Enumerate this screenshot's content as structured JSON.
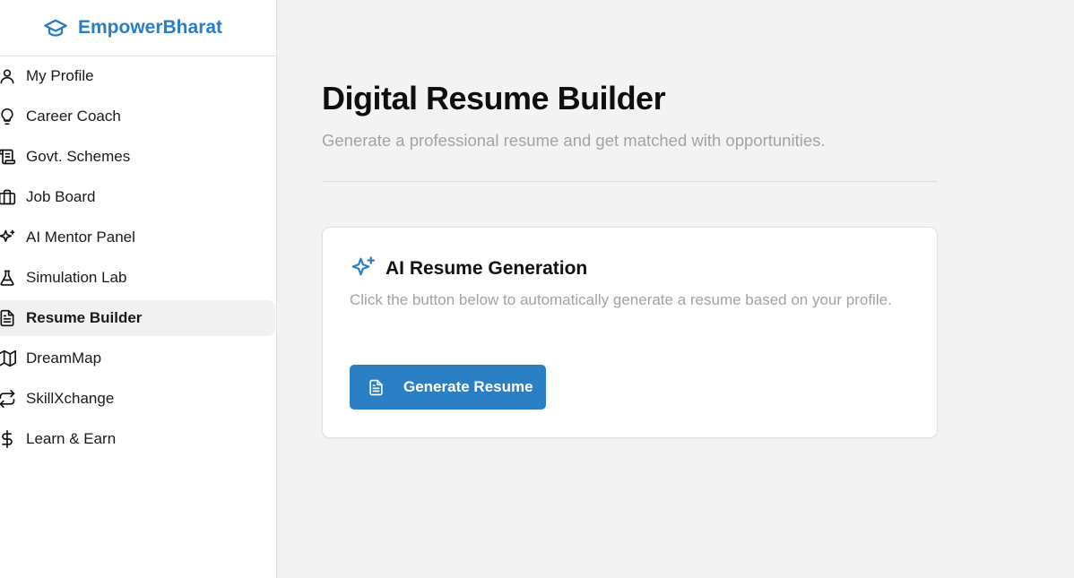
{
  "brand": {
    "name": "EmpowerBharat",
    "logo_icon": "graduation-cap-icon",
    "color": "#2b7ec4"
  },
  "sidebar": {
    "items": [
      {
        "label": "My Profile",
        "icon": "user-icon"
      },
      {
        "label": "Career Coach",
        "icon": "lightbulb-icon"
      },
      {
        "label": "Govt. Schemes",
        "icon": "scroll-icon"
      },
      {
        "label": "Job Board",
        "icon": "briefcase-icon"
      },
      {
        "label": "AI Mentor Panel",
        "icon": "sparkles-icon"
      },
      {
        "label": "Simulation Lab",
        "icon": "flask-icon"
      },
      {
        "label": "Resume Builder",
        "icon": "file-text-icon",
        "active": true
      },
      {
        "label": "DreamMap",
        "icon": "map-icon"
      },
      {
        "label": "SkillXchange",
        "icon": "repeat-icon"
      },
      {
        "label": "Learn & Earn",
        "icon": "dollar-icon"
      }
    ]
  },
  "main": {
    "title": "Digital Resume Builder",
    "subtitle": "Generate a professional resume and get matched with opportunities.",
    "card": {
      "icon": "sparkles-icon",
      "title": "AI Resume Generation",
      "description": "Click the button below to automatically generate a resume based on your profile.",
      "button_label": "Generate Resume",
      "button_icon": "file-text-icon",
      "button_color": "#2b80c5"
    }
  }
}
